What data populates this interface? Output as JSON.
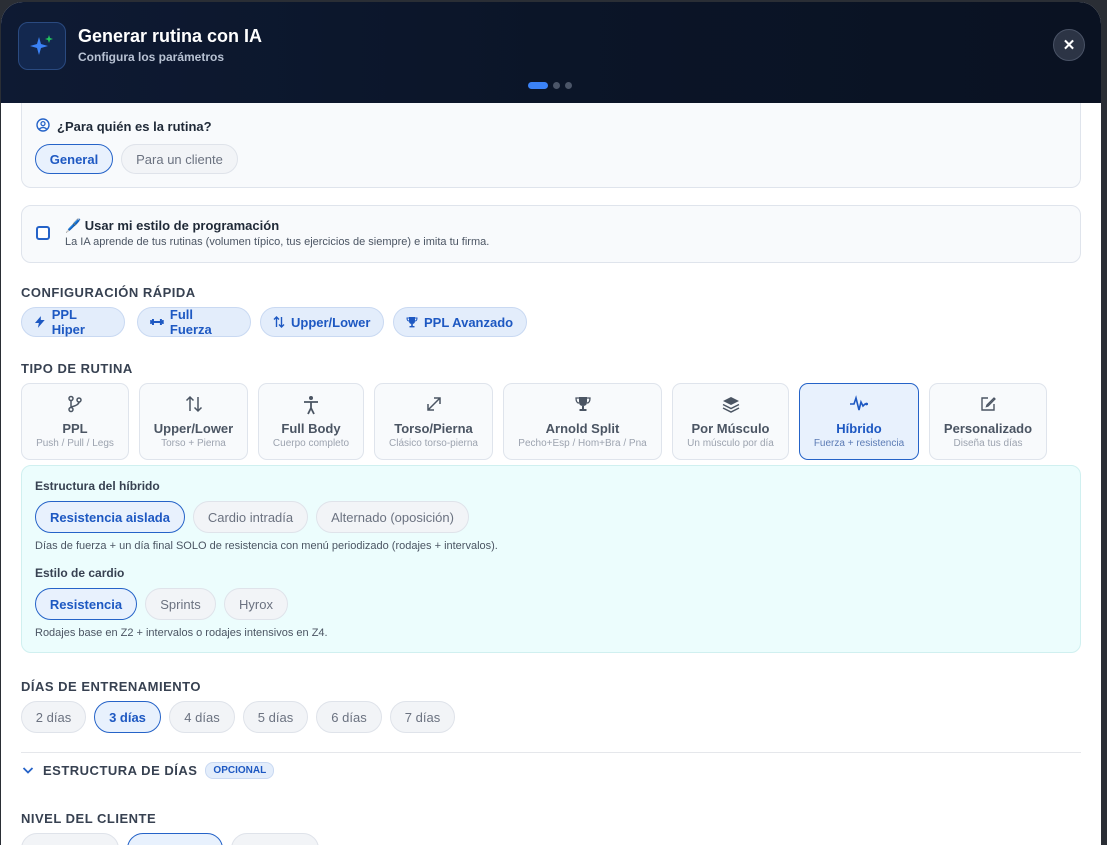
{
  "header": {
    "title": "Generar rutina con IA",
    "subtitle": "Configura los parámetros",
    "close_symbol": "✕"
  },
  "audience": {
    "question": "¿Para quién es la rutina?",
    "options": [
      "General",
      "Para un cliente"
    ],
    "selected": "General"
  },
  "style": {
    "title": "🖊️ Usar mi estilo de programación",
    "description": "La IA aprende de tus rutinas (volumen típico, tus ejercicios de siempre) e imita tu firma.",
    "checked": false
  },
  "quick_config": {
    "title": "CONFIGURACIÓN RÁPIDA",
    "presets": [
      {
        "label": "PPL Hiper",
        "icon": "bolt-icon"
      },
      {
        "label": "Full Fuerza",
        "icon": "dumbbell-icon"
      },
      {
        "label": "Upper/Lower",
        "icon": "swap-vertical-icon"
      },
      {
        "label": "PPL Avanzado",
        "icon": "trophy-icon"
      }
    ]
  },
  "routine_type": {
    "title": "TIPO DE RUTINA",
    "options": [
      {
        "title": "PPL",
        "subtitle": "Push / Pull / Legs",
        "icon": "branch-icon"
      },
      {
        "title": "Upper/Lower",
        "subtitle": "Torso + Pierna",
        "icon": "swap-vertical-icon"
      },
      {
        "title": "Full Body",
        "subtitle": "Cuerpo completo",
        "icon": "person-icon"
      },
      {
        "title": "Torso/Pierna",
        "subtitle": "Clásico torso-pierna",
        "icon": "expand-icon"
      },
      {
        "title": "Arnold Split",
        "subtitle": "Pecho+Esp / Hom+Bra / Pna",
        "icon": "trophy-icon"
      },
      {
        "title": "Por Músculo",
        "subtitle": "Un músculo por día",
        "icon": "layers-icon"
      },
      {
        "title": "Híbrido",
        "subtitle": "Fuerza + resistencia",
        "icon": "activity-icon"
      },
      {
        "title": "Personalizado",
        "subtitle": "Diseña tus días",
        "icon": "edit-icon"
      }
    ],
    "selected": "Híbrido"
  },
  "hybrid": {
    "structure_label": "Estructura del híbrido",
    "structure_options": [
      "Resistencia aislada",
      "Cardio intradía",
      "Alternado (oposición)"
    ],
    "structure_selected": "Resistencia aislada",
    "structure_note": "Días de fuerza + un día final SOLO de resistencia con menú periodizado (rodajes + intervalos).",
    "cardio_label": "Estilo de cardio",
    "cardio_options": [
      "Resistencia",
      "Sprints",
      "Hyrox"
    ],
    "cardio_selected": "Resistencia",
    "cardio_note": "Rodajes base en Z2 + intervalos o rodajes intensivos en Z4."
  },
  "training_days": {
    "title": "DÍAS DE ENTRENAMIENTO",
    "options": [
      "2 días",
      "3 días",
      "4 días",
      "5 días",
      "6 días",
      "7 días"
    ],
    "selected": "3 días"
  },
  "day_structure": {
    "title": "ESTRUCTURA DE DÍAS",
    "badge": "OPCIONAL"
  },
  "client_level": {
    "title": "NIVEL DEL CLIENTE"
  },
  "colors": {
    "accent": "#2563c8",
    "header_bg": "#0b1528",
    "hybrid_bg": "#ecfdfd"
  }
}
